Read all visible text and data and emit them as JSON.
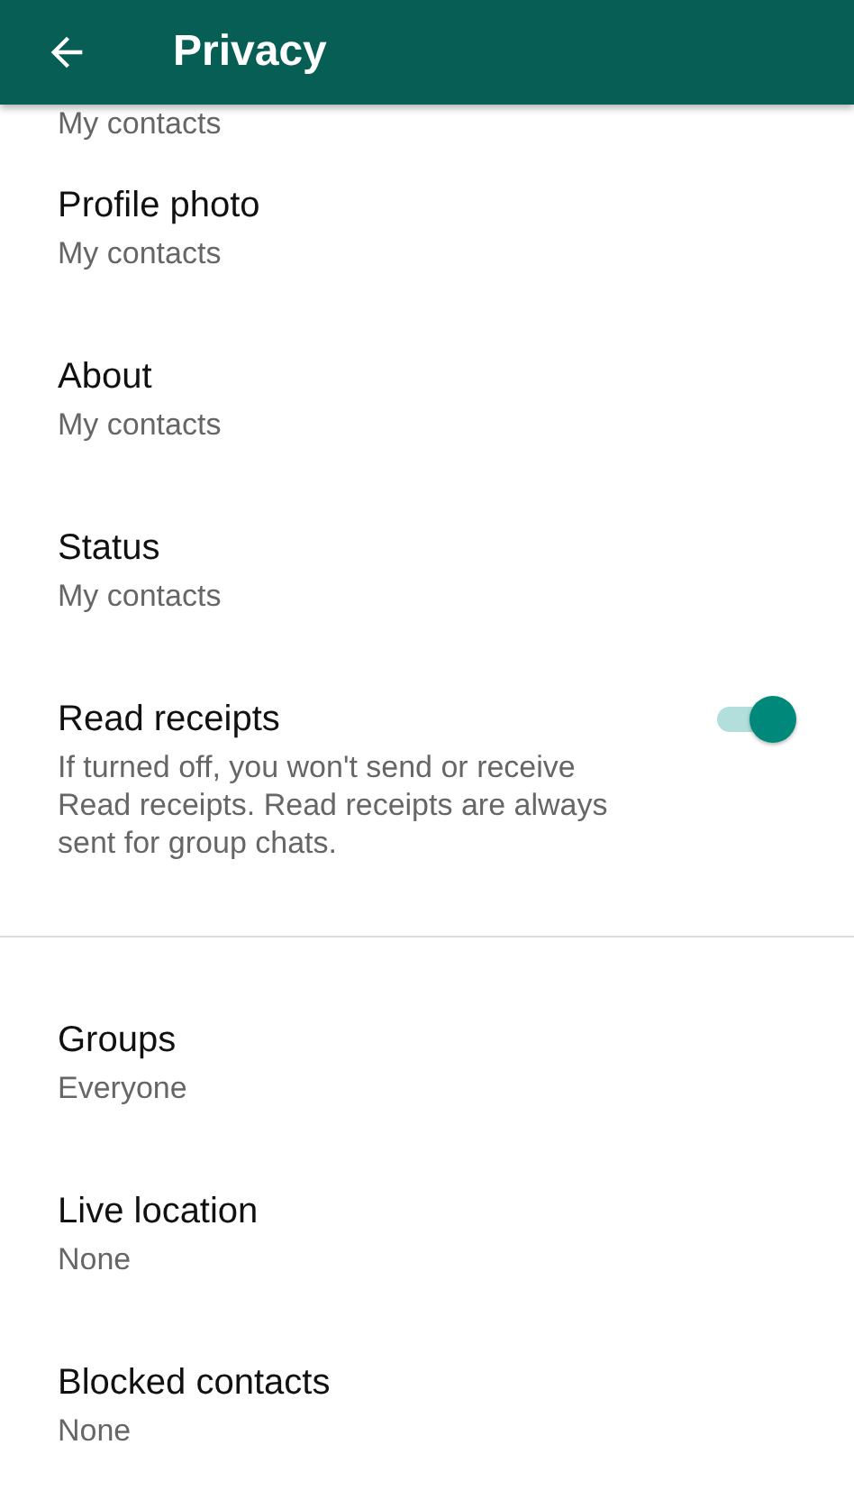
{
  "app_bar": {
    "title": "Privacy"
  },
  "cut_subtitle": "My contacts",
  "sections": [
    {
      "items": [
        {
          "kind": "option",
          "title": "Profile photo",
          "subtitle": "My contacts"
        },
        {
          "kind": "option",
          "title": "About",
          "subtitle": "My contacts"
        },
        {
          "kind": "option",
          "title": "Status",
          "subtitle": "My contacts"
        },
        {
          "kind": "toggle",
          "title": "Read receipts",
          "subtitle": "If turned off, you won't send or receive Read receipts. Read receipts are always sent for group chats.",
          "on": true
        }
      ]
    },
    {
      "items": [
        {
          "kind": "option",
          "title": "Groups",
          "subtitle": "Everyone"
        },
        {
          "kind": "option",
          "title": "Live location",
          "subtitle": "None"
        },
        {
          "kind": "option",
          "title": "Blocked contacts",
          "subtitle": "None"
        }
      ]
    }
  ]
}
